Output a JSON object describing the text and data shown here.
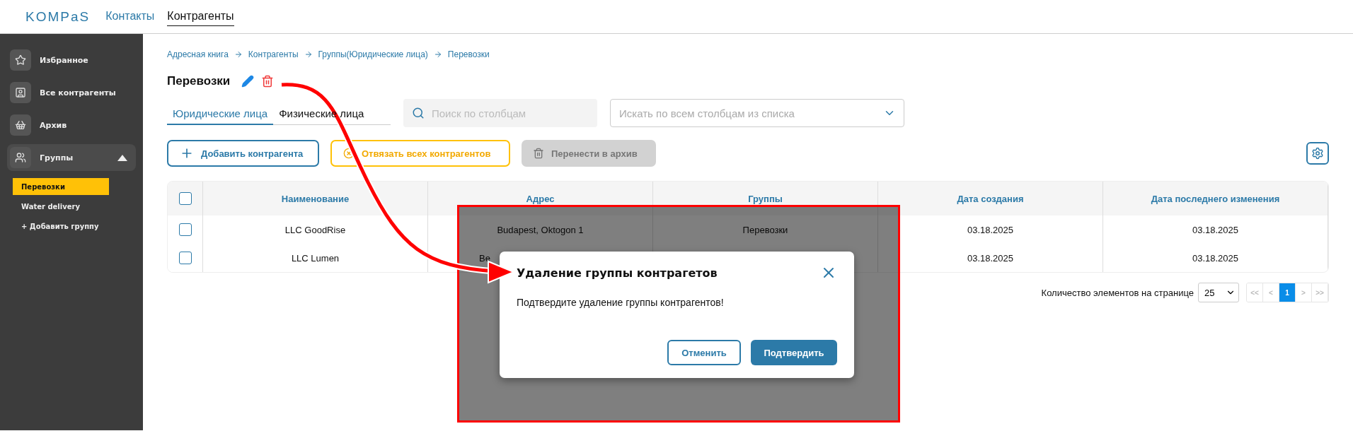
{
  "header": {
    "logo": "KOMPaS",
    "nav": [
      {
        "label": "Контакты",
        "selected": false
      },
      {
        "label": "Контрагенты",
        "selected": true
      }
    ]
  },
  "sidebar": {
    "items": [
      {
        "label": "Избранное",
        "expanded": false
      },
      {
        "label": "Все контрагенты",
        "expanded": false
      },
      {
        "label": "Архив",
        "expanded": false
      },
      {
        "label": "Группы",
        "expanded": true,
        "children": [
          {
            "label": "Перевозки",
            "selected": true
          },
          {
            "label": "Water delivery",
            "selected": false
          }
        ]
      }
    ],
    "add_group": "+ Добавить группу"
  },
  "breadcrumb": [
    "Адресная книга",
    "Контрагенты",
    "Группы(Юридические лица)",
    "Перевозки"
  ],
  "title": "Перевозки",
  "tabs": [
    {
      "label": "Юридические лица",
      "selected": true
    },
    {
      "label": "Физические лица",
      "selected": false
    }
  ],
  "search": {
    "placeholder": "Поиск по столбцам"
  },
  "column_filter": {
    "placeholder": "Искать по всем столбцам из списка"
  },
  "actions": [
    {
      "label": "Добавить контрагента",
      "kind": "primary"
    },
    {
      "label": "Отвязать всех контрагентов",
      "kind": "warning"
    },
    {
      "label": "Перенести в архив",
      "kind": "disabled"
    }
  ],
  "table": {
    "header_checked": false,
    "columns": [
      "Наименование",
      "Адрес",
      "Группы",
      "Дата создания",
      "Дата последнего изменения"
    ],
    "rows": [
      {
        "checked": false,
        "covered": false,
        "cells": [
          "LLC GoodRise",
          "Budapest, Oktogon 1",
          "Перевозки",
          "03.18.2025",
          "03.18.2025"
        ]
      },
      {
        "checked": false,
        "covered": true,
        "cells": [
          "LLC Lumen",
          "Be",
          "",
          "03.18.2025",
          "03.18.2025"
        ]
      }
    ]
  },
  "pagination": {
    "label": "Количество элементов на странице",
    "page_size": "25",
    "pages": [
      {
        "label": "<<",
        "selected": false,
        "disabled": true
      },
      {
        "label": "<",
        "selected": false,
        "disabled": true
      },
      {
        "label": "1",
        "selected": true,
        "disabled": false
      },
      {
        "label": ">",
        "selected": false,
        "disabled": true
      },
      {
        "label": ">>",
        "selected": false,
        "disabled": true
      }
    ]
  },
  "dialog": {
    "title": "Удаление группы контрагетов",
    "message": "Подтвердите удаление группы контрагентов!",
    "buttons": [
      {
        "label": "Отменить",
        "kind": "secondary"
      },
      {
        "label": "Подтвердить",
        "kind": "primary"
      }
    ]
  }
}
